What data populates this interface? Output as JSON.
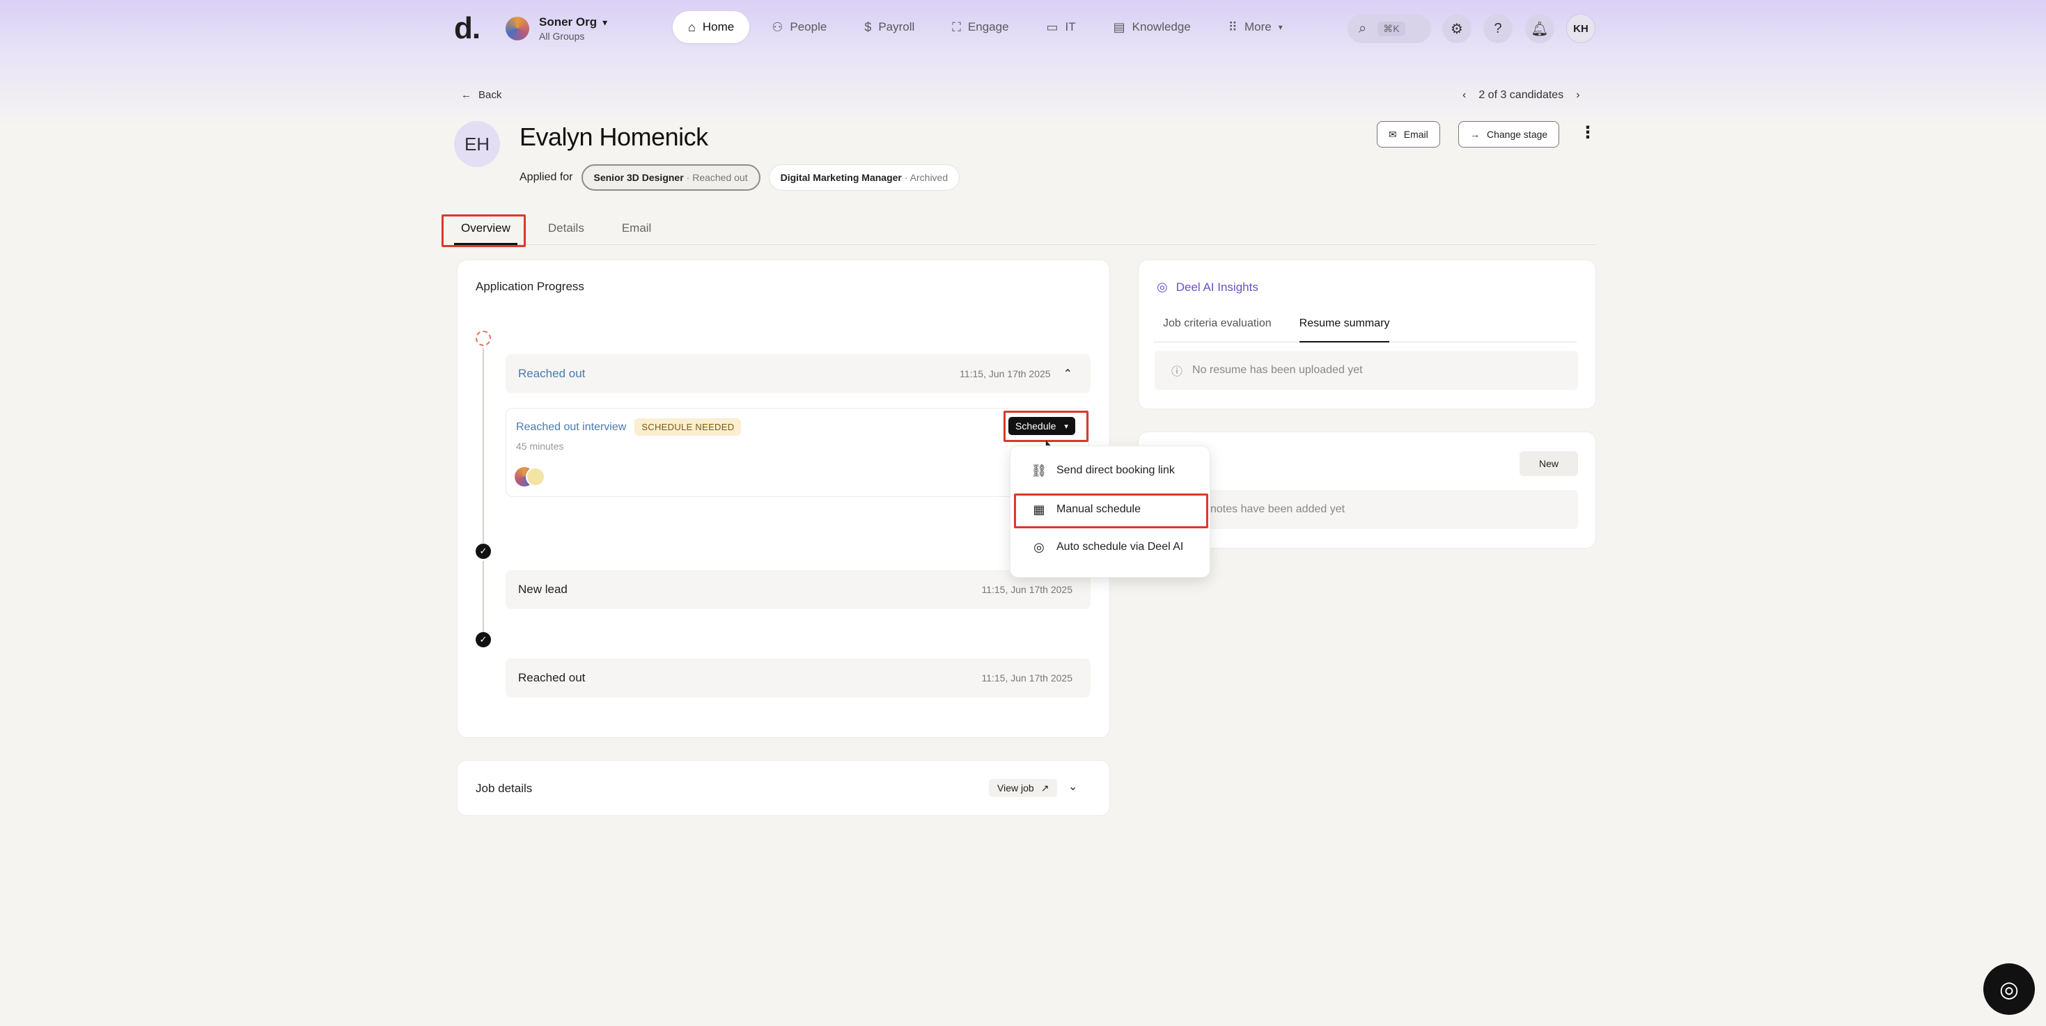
{
  "nav": {
    "logo": "d.",
    "org_name": "Soner Org",
    "org_sub": "All Groups",
    "links": [
      {
        "label": "Home",
        "icon": "home-icon",
        "active": true
      },
      {
        "label": "People",
        "icon": "people-icon"
      },
      {
        "label": "Payroll",
        "icon": "dollar-icon"
      },
      {
        "label": "Engage",
        "icon": "engage-icon"
      },
      {
        "label": "IT",
        "icon": "laptop-icon"
      },
      {
        "label": "Knowledge",
        "icon": "book-icon"
      },
      {
        "label": "More",
        "icon": "grid-icon"
      }
    ],
    "search_shortcut": "⌘K",
    "user_initials": "KH"
  },
  "header": {
    "back_label": "Back",
    "pager_label": "2 of 3 candidates",
    "initials": "EH",
    "name": "Evalyn Homenick",
    "applied_for_label": "Applied for",
    "applications": [
      {
        "role": "Senior 3D Designer",
        "status": "· Reached out",
        "selected": true
      },
      {
        "role": "Digital Marketing Manager",
        "status": "· Archived",
        "selected": false
      }
    ],
    "email_button": "Email",
    "change_stage_button": "Change stage"
  },
  "tabs": [
    "Overview",
    "Details",
    "Email"
  ],
  "progress": {
    "title": "Application Progress",
    "stages": [
      {
        "label": "Reached out",
        "time": "11:15, Jun 17th 2025"
      },
      {
        "label": "New lead",
        "time": "11:15, Jun 17th 2025"
      },
      {
        "label": "Reached out",
        "time": "11:15, Jun 17th 2025"
      }
    ],
    "interview": {
      "title": "Reached out interview",
      "badge": "SCHEDULE NEEDED",
      "duration": "45 minutes",
      "schedule_button": "Schedule"
    }
  },
  "schedule_menu": {
    "items": [
      {
        "label": "Send direct booking link",
        "icon": "link-icon"
      },
      {
        "label": "Manual schedule",
        "icon": "calendar-icon"
      },
      {
        "label": "Auto schedule via Deel AI",
        "icon": "ai-icon"
      }
    ]
  },
  "job_details": {
    "title": "Job details",
    "view_job": "View job"
  },
  "ai_insights": {
    "title": "Deel AI Insights",
    "tabs": [
      "Job criteria evaluation",
      "Resume summary"
    ],
    "empty": "No resume has been uploaded yet"
  },
  "notes": {
    "new_button": "New",
    "empty": "notes have been added yet"
  }
}
